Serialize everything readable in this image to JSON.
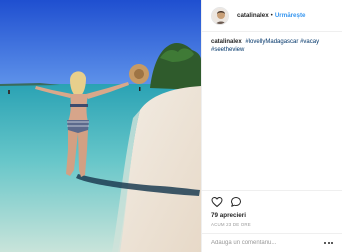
{
  "header": {
    "username": "catalinalex",
    "separator": "•",
    "follow_label": "Urmărește"
  },
  "caption": {
    "username": "catalinalex",
    "hashtags": [
      "#lovellyMadagascar",
      "#vacay",
      "#seetheview"
    ]
  },
  "actions": {
    "like_icon": "heart-outline-icon",
    "comment_icon": "speech-bubble-icon"
  },
  "likes_text": "79 aprecieri",
  "timestamp": "ACUM 23 DE ORE",
  "comment": {
    "placeholder": "Adaugă un comentariu..."
  },
  "colors": {
    "link_blue": "#3897f0",
    "hashtag_blue": "#003569",
    "muted_gray": "#999999"
  }
}
